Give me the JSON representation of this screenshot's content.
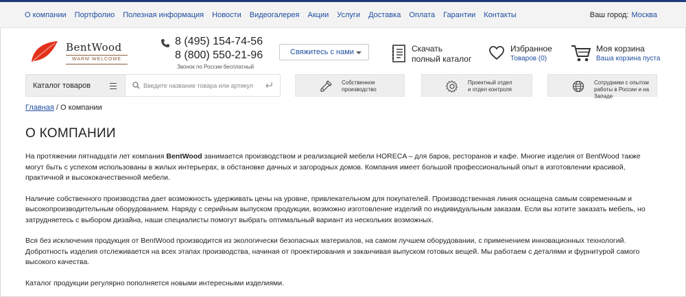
{
  "topnav": {
    "links": [
      "О компании",
      "Портфолио",
      "Полезная информация",
      "Новости",
      "Видеогалерея",
      "Акции",
      "Услуги",
      "Доставка",
      "Оплата",
      "Гарантии",
      "Контакты"
    ],
    "city_label": "Ваш город:",
    "city_value": "Москва"
  },
  "logo": {
    "brand": "BentWood",
    "tagline": "WARM WELCOME"
  },
  "phones": {
    "phone1": "8 (495) 154-74-56",
    "phone2": "8 (800) 550-21-96",
    "note": "Звонок по России бесплатный"
  },
  "contact_button": "Свяжитесь с нами",
  "catalog_download": {
    "line1": "Скачать",
    "line2": "полный каталог"
  },
  "favorites": {
    "title": "Избранное",
    "count": "Товаров (0)"
  },
  "cart": {
    "title": "Моя корзина",
    "status": "Ваша корзина пуста"
  },
  "toolbar": {
    "catalog_label": "Каталог товаров",
    "search_placeholder": "Введите название товара или артикул",
    "features": [
      {
        "label": "Собственное\nпроизводство"
      },
      {
        "label": "Проектный отдел\nи отдел контроля"
      },
      {
        "label": "Сотрудники с опытом\nработы в России и на Западе"
      }
    ]
  },
  "breadcrumb": {
    "home": "Главная",
    "separator": " / ",
    "current": "О компании"
  },
  "page_title": "О КОМПАНИИ",
  "content": {
    "p1_start": "На протяжении пятнадцати лет компания ",
    "p1_bold": "BentWood",
    "p1_end": " занимается производством и реализацией мебели HORECA – для баров, ресторанов и кафе. Многие изделия от BentWood также могут быть с успехом использованы в жилых интерьерах, в обстановке дачных и загородных домов. Компания имеет большой профессиональный опыт в изготовлении красивой, практичной и высококачественной мебели.",
    "p2": "Наличие собственного производства дает возможность удерживать цены на уровне, привлекательном для покупателей. Производственная линия оснащена самым современным и высокопроизводительным оборудованием. Наряду с серийным выпуском продукции, возможно изготовление изделий по индивидуальным заказам. Если вы хотите заказать мебель, но затрудняетесь с выбором дизайна, наши специалисты помогут выбрать оптимальный вариант из нескольких возможных.",
    "p3": "Вся без исключения продукция от BentWood производится из экологически безопасных материалов, на самом лучшем оборудовании, с применением инновационных технологий. Добротность изделия отслеживается на всех этапах производства, начиная от проектирования и заканчивая выпуском готовых вещей. Мы работаем с деталями и фурнитурой самого высокого качества.",
    "p4": "Каталог продукции регулярно пополняется новыми интересными изделиями."
  },
  "colors": {
    "accent_blue": "#1f4ea1",
    "top_bar": "#1f3b7a",
    "leaf_red": "#e2321c",
    "tag_brown": "#8a5a3a"
  }
}
